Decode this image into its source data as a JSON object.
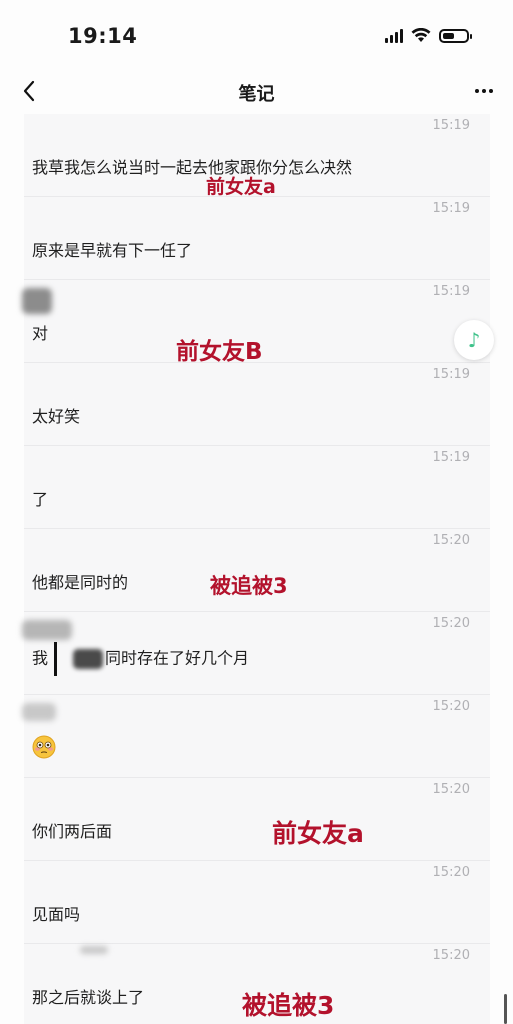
{
  "status_bar": {
    "time": "19:14",
    "battery_level": 0.5
  },
  "nav": {
    "title": "笔记",
    "back_icon": "chevron-left-icon",
    "more_icon": "more-horizontal-icon"
  },
  "messages": [
    {
      "time": "15:19",
      "text": "我草我怎么说当时一起去他家跟你分怎么决然"
    },
    {
      "time": "15:19",
      "text": "原来是早就有下一任了"
    },
    {
      "time": "15:19",
      "text": "对",
      "has_sender": true
    },
    {
      "time": "15:19",
      "text": "太好笑"
    },
    {
      "time": "15:19",
      "text": "了"
    },
    {
      "time": "15:20",
      "text": "他都是同时的"
    },
    {
      "time": "15:20",
      "text_before": "我",
      "text_after": "同时存在了好几个月",
      "has_sender": true
    },
    {
      "time": "15:20",
      "emoji": "flushed-face-emoji",
      "has_sender": true
    },
    {
      "time": "15:20",
      "text": "你们两后面"
    },
    {
      "time": "15:20",
      "text": "见面吗"
    },
    {
      "time": "15:20",
      "text": "那之后就谈上了"
    }
  ],
  "annotations": [
    {
      "text": "前女友a"
    },
    {
      "text": "前女友B"
    },
    {
      "text": "被追被3"
    },
    {
      "text": "前女友a"
    },
    {
      "text": "被追被3"
    }
  ],
  "colors": {
    "annotation": "#b3122c",
    "music_accent": "#3fc28a",
    "timestamp": "#b0b0b4"
  },
  "float_button": {
    "icon": "music-note-icon",
    "glyph": "♪"
  }
}
